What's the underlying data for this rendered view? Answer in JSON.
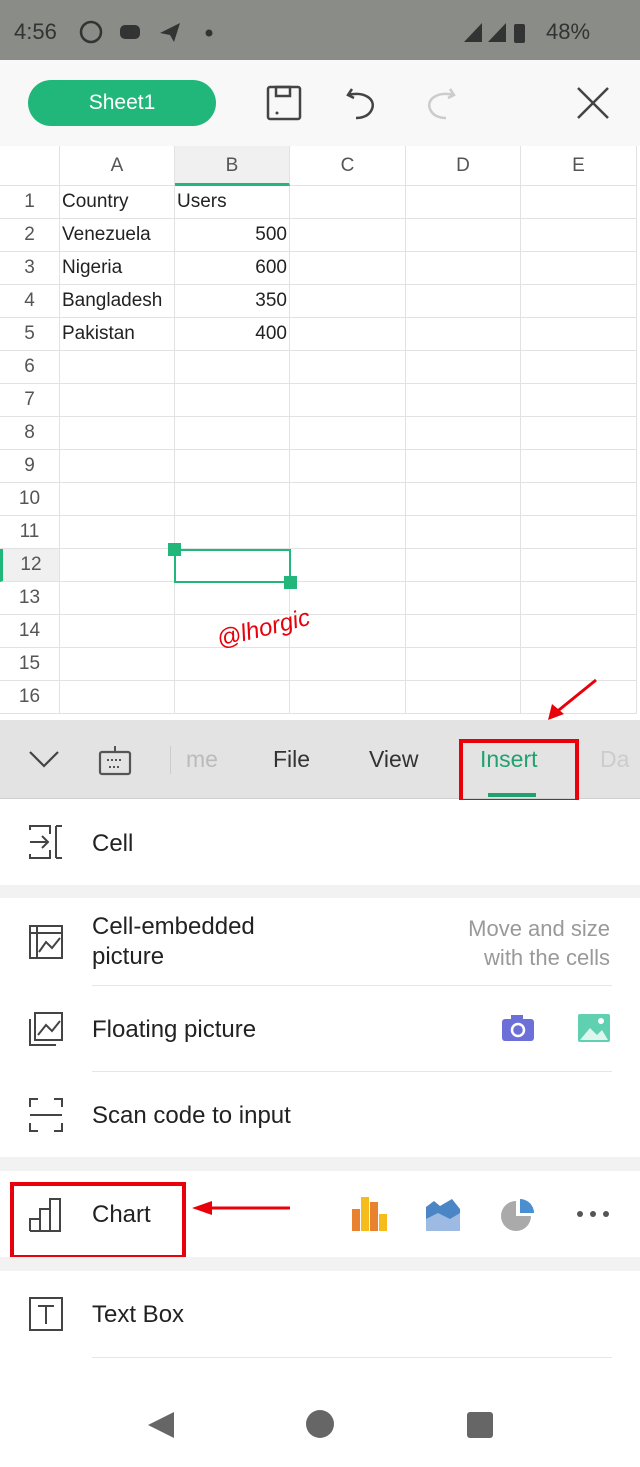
{
  "status": {
    "time": "4:56",
    "battery": "48%",
    "icons": [
      "whatsapp-icon",
      "discord-icon",
      "telegram-icon",
      "dot-icon",
      "signal-alert-icon",
      "signal-icon",
      "battery-icon"
    ]
  },
  "header": {
    "sheet_tab": "Sheet1",
    "icons": [
      "save-icon",
      "undo-icon",
      "redo-icon",
      "close-icon"
    ]
  },
  "grid": {
    "columns": [
      "A",
      "B",
      "C",
      "D",
      "E"
    ],
    "rows": [
      "1",
      "2",
      "3",
      "4",
      "5",
      "6",
      "7",
      "8",
      "9",
      "10",
      "11",
      "12",
      "13",
      "14",
      "15",
      "16"
    ],
    "cells": [
      [
        "Country",
        "Users"
      ],
      [
        "Venezuela",
        "500"
      ],
      [
        "Nigeria",
        "600"
      ],
      [
        "Bangladesh",
        "350"
      ],
      [
        "Pakistan",
        "400"
      ]
    ],
    "selected": "B12",
    "accent": "#22b77a"
  },
  "watermark": "@lhorgic",
  "toolbar": {
    "tabs": [
      "me",
      "File",
      "View",
      "Insert",
      "Da"
    ],
    "active": "Insert"
  },
  "menu": {
    "cell": "Cell",
    "embedded": "Cell-embedded picture",
    "embedded_note": "Move and size with the cells",
    "floating": "Floating picture",
    "scan": "Scan code to input",
    "chart": "Chart",
    "textbox": "Text Box"
  },
  "annotation_color": "#e8000b"
}
